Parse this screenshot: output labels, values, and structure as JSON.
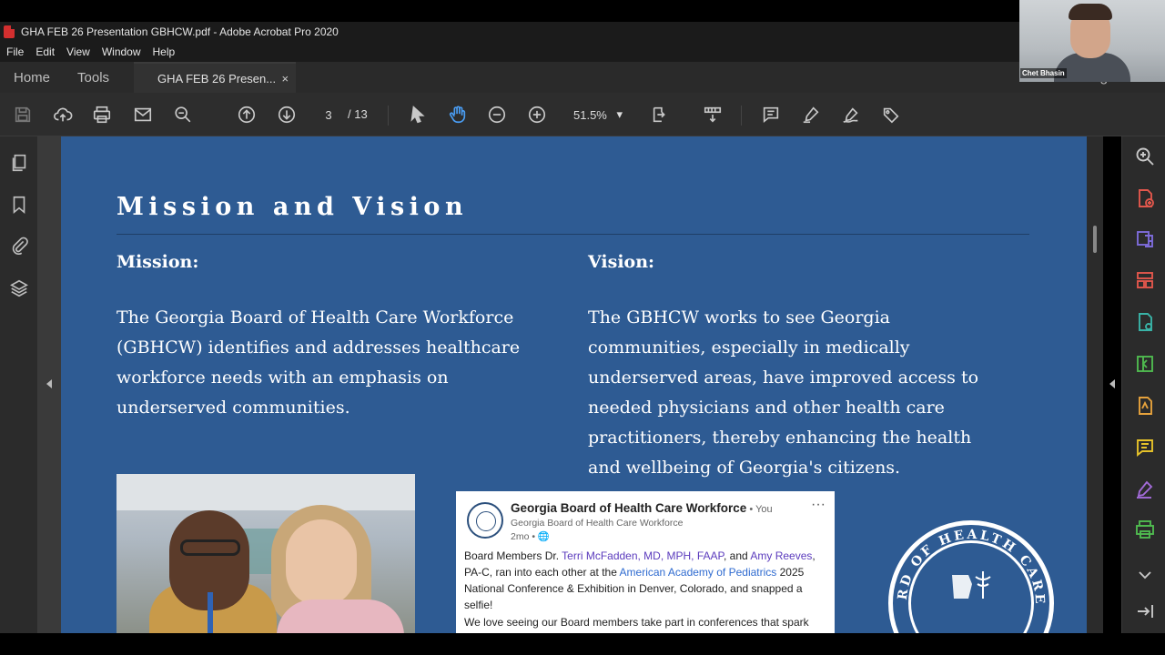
{
  "window": {
    "title": "GHA FEB 26 Presentation GBHCW.pdf - Adobe Acrobat Pro 2020"
  },
  "menu": [
    "File",
    "Edit",
    "View",
    "Window",
    "Help"
  ],
  "tabs": {
    "home": "Home",
    "tools": "Tools",
    "document": "GHA FEB 26 Presen...",
    "close": "×",
    "sign_in": "Sign In"
  },
  "toolbar": {
    "page_current": "3",
    "page_total": "/ 13",
    "zoom": "51.5%",
    "zoom_caret": "▾"
  },
  "slide": {
    "title": "Mission and Vision",
    "mission_heading": "Mission:",
    "mission_text": "The Georgia Board of Health Care Workforce (GBHCW) identifies and addresses healthcare workforce needs with an emphasis on underserved communities.",
    "vision_heading": "Vision:",
    "vision_text": "The GBHCW works to see Georgia communities, especially in medically underserved areas, have improved access to needed physicians and other health care practitioners, thereby enhancing the health and wellbeing of Georgia's citizens."
  },
  "post": {
    "org_name": "Georgia Board of Health Care Workforce",
    "you": " • You",
    "subtitle": "Georgia Board of Health Care Workforce",
    "meta": "2mo • 🌐",
    "more": "···",
    "text_1": "Board Members Dr. ",
    "link_1": "Terri McFadden, MD, MPH, FAAP",
    "text_2": ", and ",
    "link_2": "Amy Reeves",
    "text_3": ", PA-C, ran into each other at the ",
    "link_3": "American Academy of Pediatrics",
    "text_4": " 2025 National Conference & Exhibition in Denver, Colorado, and snapped a selfie!",
    "text_5": "We love seeing our Board members take part in conferences that spark"
  },
  "seal": {
    "text": "GEORGIA BOARD OF HEALTH CARE WORKFORCE"
  },
  "webcam": {
    "name": "Chet Bhasin"
  }
}
